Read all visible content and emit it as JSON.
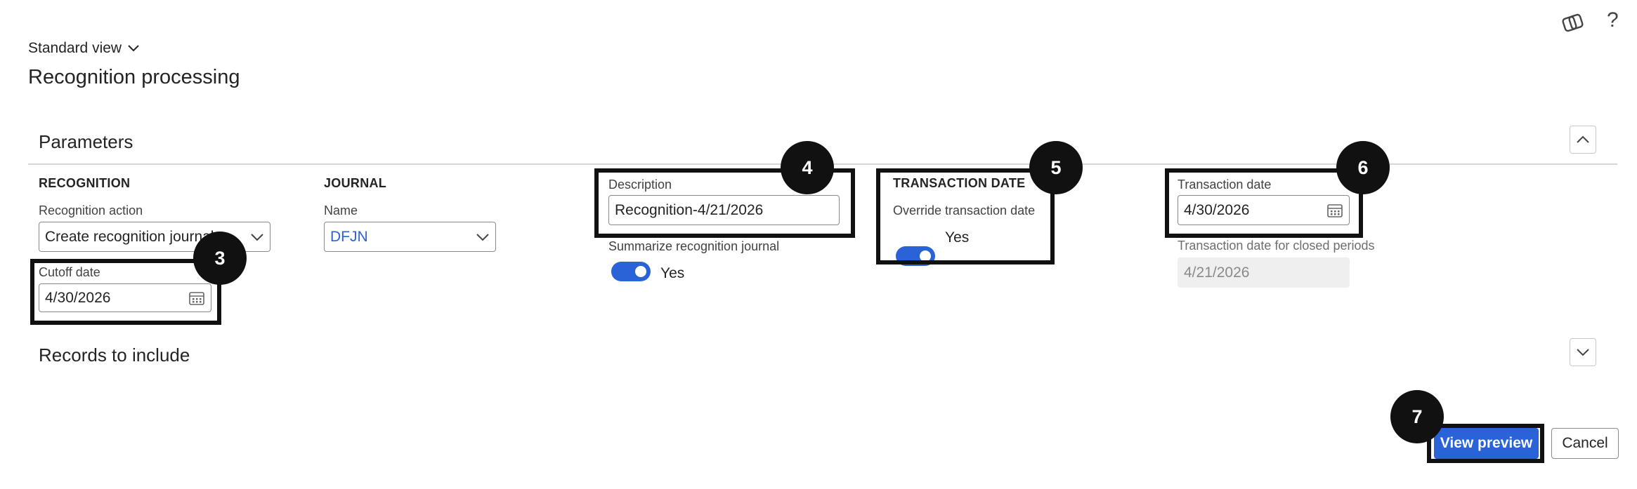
{
  "header": {
    "copilot_icon": "copilot-icon",
    "help_icon": "question-mark-icon",
    "help_glyph": "?",
    "view_label": "Standard view",
    "page_title": "Recognition processing"
  },
  "parameters": {
    "title": "Parameters",
    "recognition": {
      "heading": "RECOGNITION",
      "action_label": "Recognition action",
      "action_value": "Create recognition journal",
      "cutoff_label": "Cutoff date",
      "cutoff_value": "4/30/2026"
    },
    "journal": {
      "heading": "JOURNAL",
      "name_label": "Name",
      "name_value": "DFJN"
    },
    "description": {
      "label": "Description",
      "value": "Recognition-4/21/2026",
      "summarize_label": "Summarize recognition journal",
      "summarize_value": "Yes",
      "summarize_on": true
    },
    "transaction_date_group": {
      "heading": "TRANSACTION DATE",
      "override_label": "Override transaction date",
      "override_value": "Yes",
      "override_on": true
    },
    "transaction_date": {
      "label": "Transaction date",
      "value": "4/30/2026",
      "closed_label": "Transaction date for closed periods",
      "closed_value": "4/21/2026"
    }
  },
  "records": {
    "title": "Records to include"
  },
  "callouts": {
    "c3": "3",
    "c4": "4",
    "c5": "5",
    "c6": "6",
    "c7": "7"
  },
  "footer": {
    "preview_label": "View preview",
    "cancel_label": "Cancel"
  },
  "colors": {
    "accent": "#2a62d8",
    "callout": "#111111",
    "disabled_bg": "#efefef"
  }
}
